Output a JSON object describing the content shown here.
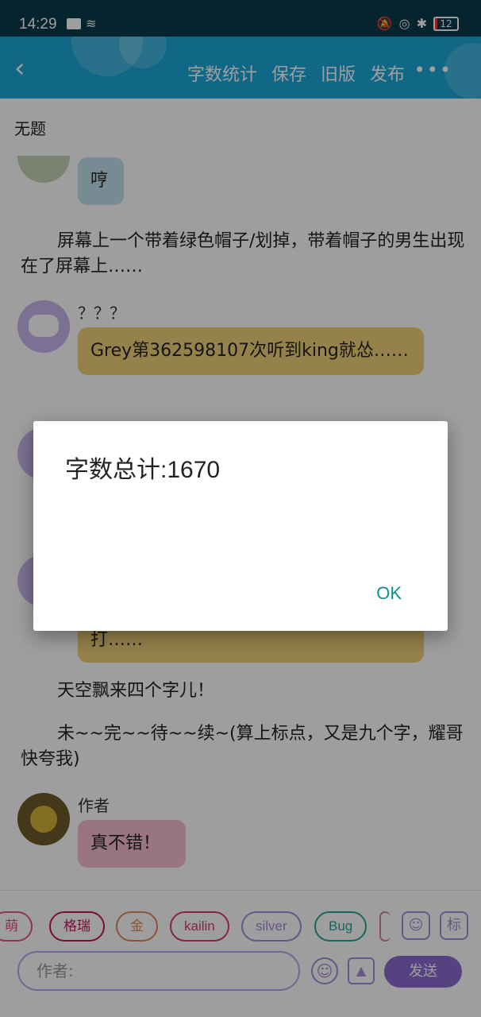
{
  "status": {
    "time": "14:29",
    "battery": "12"
  },
  "toolbar": {
    "actions": [
      "字数统计",
      "保存",
      "旧版",
      "发布"
    ],
    "more": "•••"
  },
  "doc": {
    "title": "无题"
  },
  "messages": {
    "m1_text": "哼",
    "narr1": "屏幕上一个带着绿色帽子/划掉，带着帽子的男生出现在了屏幕上……",
    "m2_speaker": "？？？",
    "m2_text": "Grey第362598107次听到king就怂……",
    "m3_partial": "打……",
    "narr2": "天空飘来四个字儿！",
    "narr3": "未~~完~~待~~续~(算上标点，又是九个字，耀哥快夸我)",
    "m4_speaker": "作者",
    "m4_text": "真不错！"
  },
  "chips": [
    {
      "label": "萌",
      "color": "#e05b7b"
    },
    {
      "label": "格瑞",
      "color": "#c2185b"
    },
    {
      "label": "金",
      "color": "#e0895a"
    },
    {
      "label": "kailin",
      "color": "#d93a6a"
    },
    {
      "label": "silver",
      "color": "#a78bd8"
    },
    {
      "label": "Bug",
      "color": "#2aa59a"
    },
    {
      "label": "",
      "color": "#d97fb0"
    }
  ],
  "bottom": {
    "tag_btn": "标",
    "input_placeholder": "作者:",
    "send": "发送"
  },
  "dialog": {
    "message": "字数总计:1670",
    "ok": "OK"
  }
}
